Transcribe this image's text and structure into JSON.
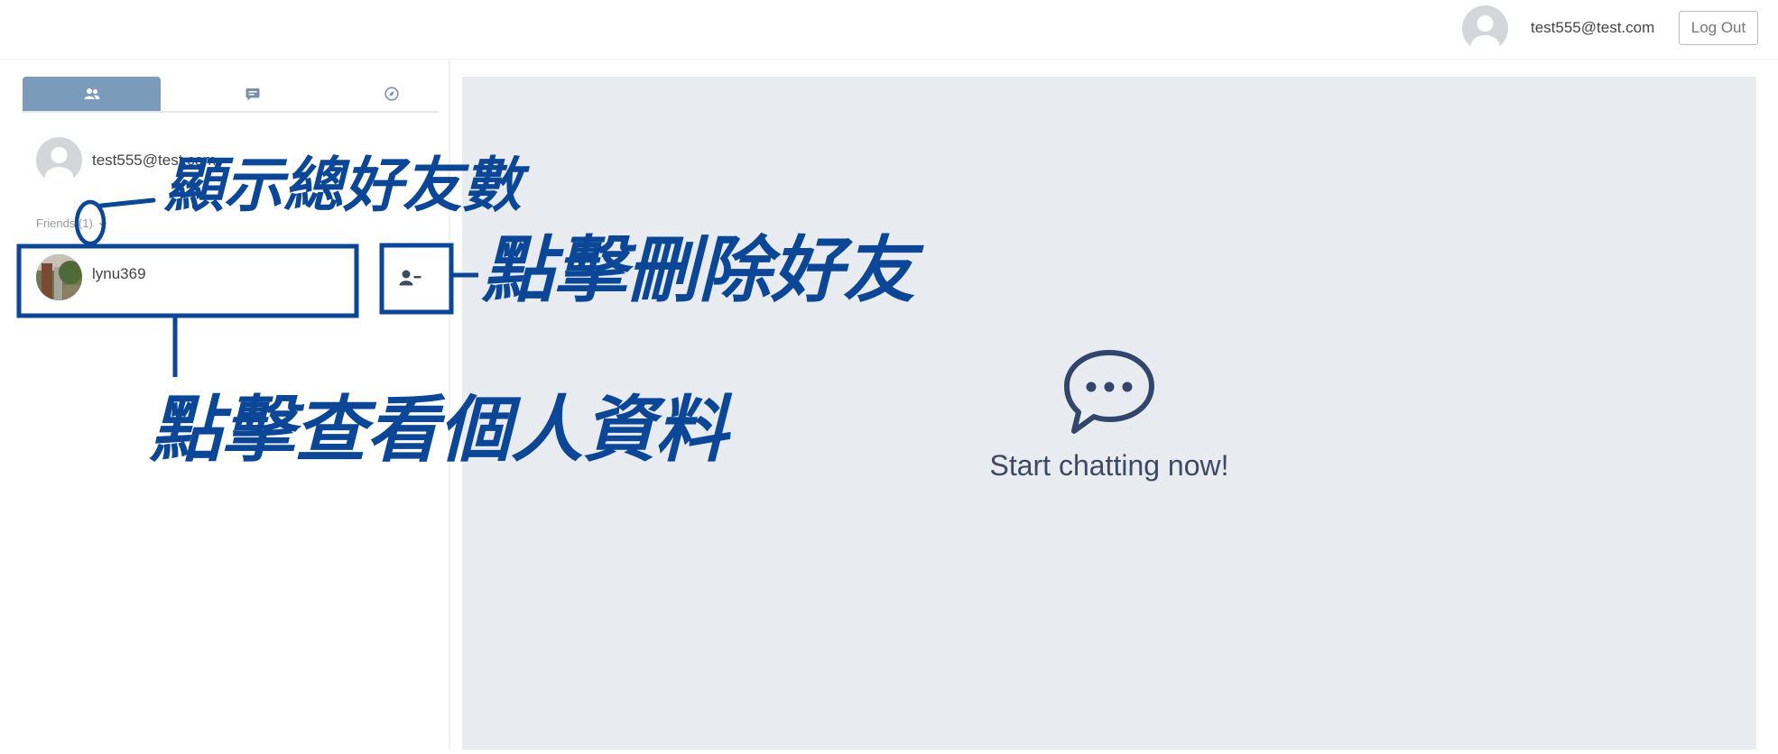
{
  "header": {
    "user_email": "test555@test.com",
    "logout_label": "Log Out"
  },
  "sidebar": {
    "tabs": [
      {
        "icon": "friends-icon",
        "active": true
      },
      {
        "icon": "chat-icon",
        "active": false
      },
      {
        "icon": "compass-icon",
        "active": false
      }
    ],
    "me": {
      "email": "test555@test.com"
    },
    "friends_label": "Friends (1)",
    "friends": [
      {
        "name": "lynu369"
      }
    ]
  },
  "main": {
    "empty_state_icon": "chat-bubble-icon",
    "empty_state_text": "Start chatting now!"
  },
  "annotations": {
    "friend_count_note": "顯示總好友數",
    "remove_note": "點擊刪除好友",
    "profile_note": "點擊查看個人資料",
    "color": "#0b4796"
  },
  "colors": {
    "tab_active": "#7b9bbb",
    "main_bg": "#e8ebf0",
    "accent_text": "#3d4a63"
  }
}
